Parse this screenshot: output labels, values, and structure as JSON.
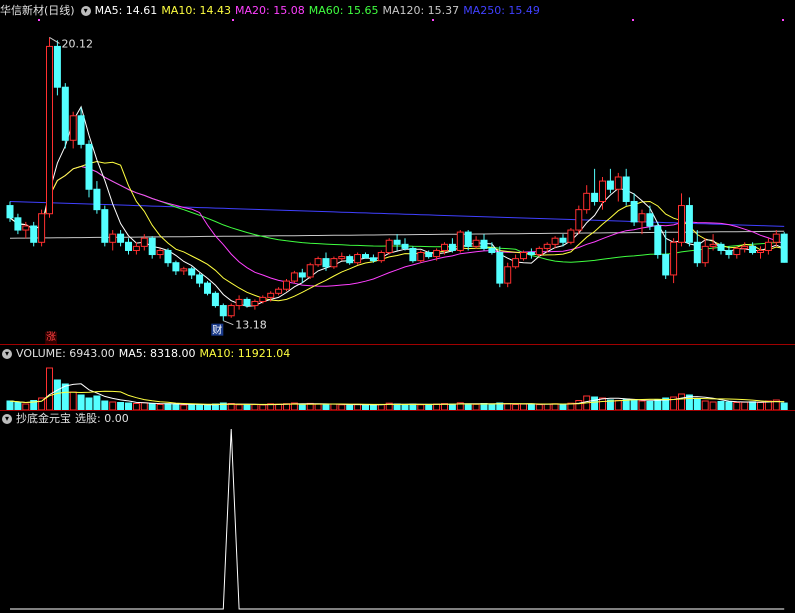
{
  "price_header": {
    "name": "华信新材(日线)",
    "ma5": "MA5: 14.61",
    "ma10": "MA10: 14.43",
    "ma20": "MA20: 15.08",
    "ma60": "MA60: 15.65",
    "ma120": "MA120: 15.37",
    "ma250": "MA250: 15.49"
  },
  "volume_header": {
    "name": "VOLUME: 6943.00",
    "ma5": "MA5: 8318.00",
    "ma10": "MA10: 11921.04"
  },
  "indicator_header": {
    "name": "抄底金元宝",
    "value": "选股: 0.00"
  },
  "markers": {
    "high_label": "20.12",
    "low_label": "13.18",
    "zhang": "涨",
    "cai": "财"
  },
  "colors": {
    "up": "#ff3030",
    "down": "#54ffff",
    "ma5": "#ffffff",
    "ma10": "#ffff40",
    "ma20": "#ff40ff",
    "ma60": "#40ff40",
    "ma120": "#c8c8c8",
    "ma250": "#4040ff"
  },
  "chart_data": [
    {
      "type": "candlestick",
      "title": "华信新材(日线)",
      "x": [
        1,
        2,
        3,
        4,
        5,
        6,
        7,
        8,
        9,
        10,
        11,
        12,
        13,
        14,
        15,
        16,
        17,
        18,
        19,
        20,
        21,
        22,
        23,
        24,
        25,
        26,
        27,
        28,
        29,
        30,
        31,
        32,
        33,
        34,
        35,
        36,
        37,
        38,
        39,
        40,
        41,
        42,
        43,
        44,
        45,
        46,
        47,
        48,
        49,
        50,
        51,
        52,
        53,
        54,
        55,
        56,
        57,
        58,
        59,
        60,
        61,
        62,
        63,
        64,
        65,
        66,
        67,
        68,
        69,
        70,
        71,
        72,
        73,
        74,
        75,
        76,
        77,
        78,
        79,
        80,
        81,
        82,
        83,
        84,
        85,
        86,
        87,
        88,
        89,
        90,
        91,
        92,
        93,
        94,
        95,
        96,
        97,
        98,
        99
      ],
      "ohlc": [
        [
          16.0,
          16.1,
          15.6,
          15.7
        ],
        [
          15.7,
          15.8,
          15.3,
          15.4
        ],
        [
          15.4,
          15.6,
          15.2,
          15.5
        ],
        [
          15.5,
          15.6,
          15.0,
          15.1
        ],
        [
          15.1,
          15.9,
          15.0,
          15.8
        ],
        [
          15.8,
          20.12,
          15.7,
          19.9
        ],
        [
          19.9,
          20.05,
          18.7,
          18.9
        ],
        [
          18.9,
          19.0,
          17.4,
          17.6
        ],
        [
          17.6,
          18.3,
          17.4,
          18.2
        ],
        [
          18.2,
          18.4,
          17.4,
          17.5
        ],
        [
          17.5,
          17.6,
          16.2,
          16.4
        ],
        [
          16.4,
          16.6,
          15.8,
          15.9
        ],
        [
          15.9,
          16.0,
          15.0,
          15.1
        ],
        [
          15.1,
          15.4,
          14.9,
          15.3
        ],
        [
          15.3,
          15.4,
          15.0,
          15.1
        ],
        [
          15.1,
          15.2,
          14.8,
          14.9
        ],
        [
          14.9,
          15.1,
          14.8,
          15.0
        ],
        [
          15.0,
          15.3,
          14.9,
          15.2
        ],
        [
          15.2,
          15.25,
          14.7,
          14.8
        ],
        [
          14.8,
          14.95,
          14.7,
          14.9
        ],
        [
          14.9,
          14.95,
          14.5,
          14.6
        ],
        [
          14.6,
          14.65,
          14.3,
          14.4
        ],
        [
          14.4,
          14.5,
          14.3,
          14.45
        ],
        [
          14.45,
          14.5,
          14.2,
          14.3
        ],
        [
          14.3,
          14.35,
          14.0,
          14.1
        ],
        [
          14.1,
          14.15,
          13.8,
          13.85
        ],
        [
          13.85,
          13.9,
          13.5,
          13.55
        ],
        [
          13.55,
          13.6,
          13.18,
          13.3
        ],
        [
          13.3,
          13.6,
          13.25,
          13.55
        ],
        [
          13.55,
          13.8,
          13.45,
          13.7
        ],
        [
          13.7,
          13.75,
          13.5,
          13.55
        ],
        [
          13.55,
          13.7,
          13.45,
          13.65
        ],
        [
          13.65,
          13.8,
          13.6,
          13.75
        ],
        [
          13.75,
          13.9,
          13.65,
          13.85
        ],
        [
          13.85,
          14.0,
          13.8,
          13.95
        ],
        [
          13.95,
          14.2,
          13.9,
          14.15
        ],
        [
          14.15,
          14.4,
          14.1,
          14.35
        ],
        [
          14.35,
          14.45,
          14.1,
          14.25
        ],
        [
          14.25,
          14.6,
          14.2,
          14.55
        ],
        [
          14.55,
          14.75,
          14.5,
          14.7
        ],
        [
          14.7,
          14.85,
          14.4,
          14.5
        ],
        [
          14.5,
          14.75,
          14.45,
          14.7
        ],
        [
          14.7,
          14.85,
          14.65,
          14.75
        ],
        [
          14.75,
          14.8,
          14.55,
          14.6
        ],
        [
          14.6,
          14.85,
          14.55,
          14.8
        ],
        [
          14.8,
          14.85,
          14.7,
          14.72
        ],
        [
          14.72,
          14.8,
          14.6,
          14.65
        ],
        [
          14.65,
          14.9,
          14.6,
          14.85
        ],
        [
          14.85,
          15.2,
          14.8,
          15.15
        ],
        [
          15.15,
          15.3,
          14.9,
          15.05
        ],
        [
          15.05,
          15.2,
          14.9,
          14.95
        ],
        [
          14.95,
          15.0,
          14.6,
          14.65
        ],
        [
          14.65,
          14.9,
          14.6,
          14.85
        ],
        [
          14.85,
          14.9,
          14.7,
          14.75
        ],
        [
          14.75,
          14.95,
          14.65,
          14.9
        ],
        [
          14.9,
          15.1,
          14.8,
          15.05
        ],
        [
          15.05,
          15.2,
          14.85,
          14.9
        ],
        [
          14.9,
          15.4,
          14.85,
          15.35
        ],
        [
          15.35,
          15.4,
          14.9,
          15.0
        ],
        [
          15.0,
          15.25,
          14.95,
          15.15
        ],
        [
          15.15,
          15.3,
          14.9,
          14.95
        ],
        [
          14.95,
          15.1,
          14.8,
          14.85
        ],
        [
          14.85,
          15.0,
          14.0,
          14.1
        ],
        [
          14.1,
          14.6,
          14.0,
          14.5
        ],
        [
          14.5,
          14.8,
          14.45,
          14.7
        ],
        [
          14.7,
          14.9,
          14.65,
          14.85
        ],
        [
          14.85,
          14.95,
          14.7,
          14.8
        ],
        [
          14.8,
          15.0,
          14.75,
          14.95
        ],
        [
          14.95,
          15.1,
          14.85,
          15.05
        ],
        [
          15.05,
          15.25,
          14.95,
          15.2
        ],
        [
          15.2,
          15.3,
          15.0,
          15.1
        ],
        [
          15.1,
          15.45,
          15.05,
          15.4
        ],
        [
          15.4,
          16.0,
          15.3,
          15.9
        ],
        [
          15.9,
          16.5,
          15.8,
          16.3
        ],
        [
          16.3,
          16.9,
          16.0,
          16.1
        ],
        [
          16.1,
          16.7,
          15.9,
          16.6
        ],
        [
          16.6,
          16.9,
          16.3,
          16.4
        ],
        [
          16.4,
          16.8,
          16.1,
          16.7
        ],
        [
          16.7,
          16.9,
          16.0,
          16.1
        ],
        [
          16.1,
          16.3,
          15.5,
          15.6
        ],
        [
          15.6,
          15.9,
          15.3,
          15.8
        ],
        [
          15.8,
          16.0,
          15.4,
          15.5
        ],
        [
          15.5,
          15.6,
          14.7,
          14.8
        ],
        [
          14.8,
          15.4,
          14.2,
          14.3
        ],
        [
          14.3,
          15.2,
          14.1,
          15.1
        ],
        [
          15.1,
          16.3,
          15.0,
          16.0
        ],
        [
          16.0,
          16.2,
          15.0,
          15.1
        ],
        [
          15.1,
          15.4,
          14.5,
          14.6
        ],
        [
          14.6,
          15.2,
          14.5,
          15.0
        ],
        [
          15.0,
          15.3,
          14.9,
          15.05
        ],
        [
          15.05,
          15.1,
          14.8,
          14.9
        ],
        [
          14.9,
          15.0,
          14.7,
          14.8
        ],
        [
          14.8,
          15.0,
          14.7,
          14.95
        ],
        [
          14.95,
          15.1,
          14.85,
          15.0
        ],
        [
          15.0,
          15.1,
          14.8,
          14.85
        ],
        [
          14.85,
          15.0,
          14.7,
          14.9
        ],
        [
          14.9,
          15.2,
          14.8,
          15.1
        ],
        [
          15.1,
          15.4,
          15.0,
          15.3
        ],
        [
          15.3,
          15.35,
          14.6,
          14.61
        ]
      ],
      "ylim": [
        13.0,
        20.4
      ],
      "series": [
        {
          "name": "MA250",
          "values_start": 16.1,
          "values_end": 15.49
        },
        {
          "name": "MA120",
          "values_start": 15.2,
          "values_end": 15.37
        }
      ]
    },
    {
      "type": "bar",
      "title": "VOLUME",
      "values": [
        9000,
        7500,
        6000,
        9500,
        12000,
        42000,
        30000,
        26000,
        18000,
        15000,
        12000,
        14000,
        9000,
        8000,
        7500,
        7000,
        6500,
        7200,
        6000,
        5500,
        6200,
        5800,
        5000,
        5600,
        5300,
        4800,
        6000,
        7000,
        6500,
        5200,
        5000,
        5400,
        5100,
        6200,
        5800,
        6300,
        7000,
        5500,
        6600,
        5900,
        5400,
        6000,
        5200,
        5000,
        5600,
        5300,
        5100,
        5500,
        6800,
        6000,
        5400,
        5800,
        5200,
        5600,
        6000,
        6400,
        5900,
        7200,
        6100,
        5700,
        6500,
        5800,
        7000,
        6300,
        5500,
        5900,
        6100,
        5400,
        6000,
        6200,
        5700,
        6800,
        9500,
        14000,
        13000,
        12000,
        10000,
        9500,
        11000,
        10500,
        9000,
        8500,
        10000,
        12000,
        13000,
        16000,
        15000,
        11000,
        9000,
        8000,
        8500,
        8000,
        7500,
        7800,
        8200,
        7600,
        9000,
        10000,
        6943
      ],
      "ylim": [
        0,
        46000
      ]
    },
    {
      "type": "line",
      "title": "抄底金元宝",
      "values": [
        0,
        0,
        0,
        0,
        0,
        0,
        0,
        0,
        0,
        0,
        0,
        0,
        0,
        0,
        0,
        0,
        0,
        0,
        0,
        0,
        0,
        0,
        0,
        0,
        0,
        0,
        0,
        0,
        0,
        0,
        0,
        0,
        0,
        0,
        0,
        0,
        0,
        0,
        0,
        0,
        0,
        0,
        0,
        0,
        0,
        0,
        0,
        0,
        0,
        0,
        0,
        0,
        0,
        0,
        0,
        0,
        0,
        0,
        0,
        0,
        0,
        0,
        0,
        0,
        0,
        0,
        0,
        0,
        0,
        0,
        0,
        0,
        0,
        0,
        0,
        0,
        0,
        0,
        0,
        0,
        0,
        0,
        0,
        0,
        0,
        0,
        0,
        0,
        0,
        0,
        0,
        0,
        0,
        0,
        0,
        0,
        0,
        0,
        0
      ],
      "spike": {
        "x": 28,
        "y": 1
      }
    }
  ]
}
